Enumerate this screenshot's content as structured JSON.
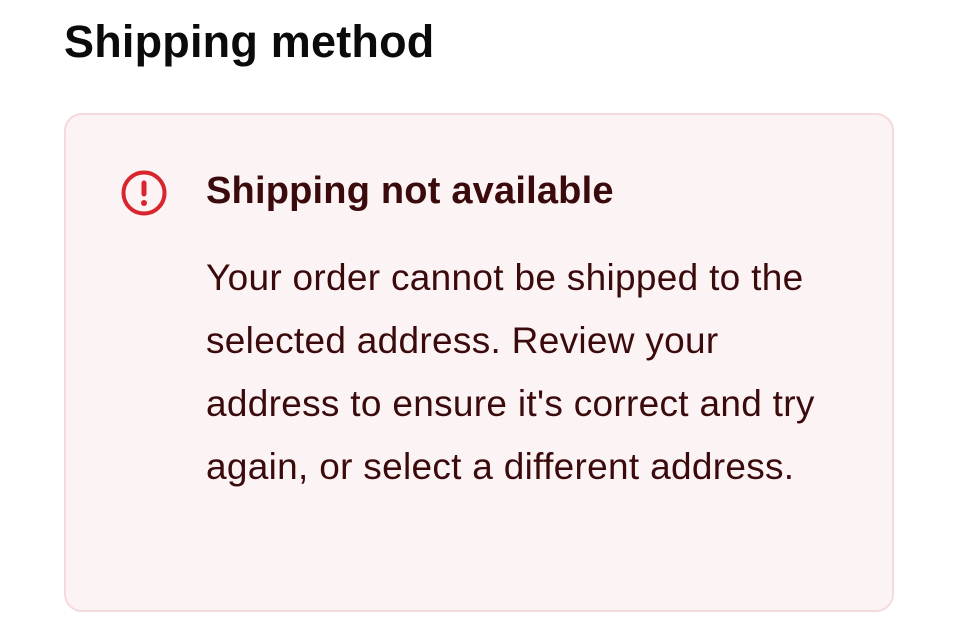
{
  "section": {
    "title": "Shipping method"
  },
  "alert": {
    "icon": "alert-circle-icon",
    "title": "Shipping not available",
    "message": "Your order cannot be shipped to the selected address. Review your address to ensure it's correct and try again, or select a different address.",
    "colors": {
      "background": "#fcf4f4",
      "border": "#f6d9da",
      "icon": "#d9262e",
      "text": "#3b0a0c"
    }
  }
}
